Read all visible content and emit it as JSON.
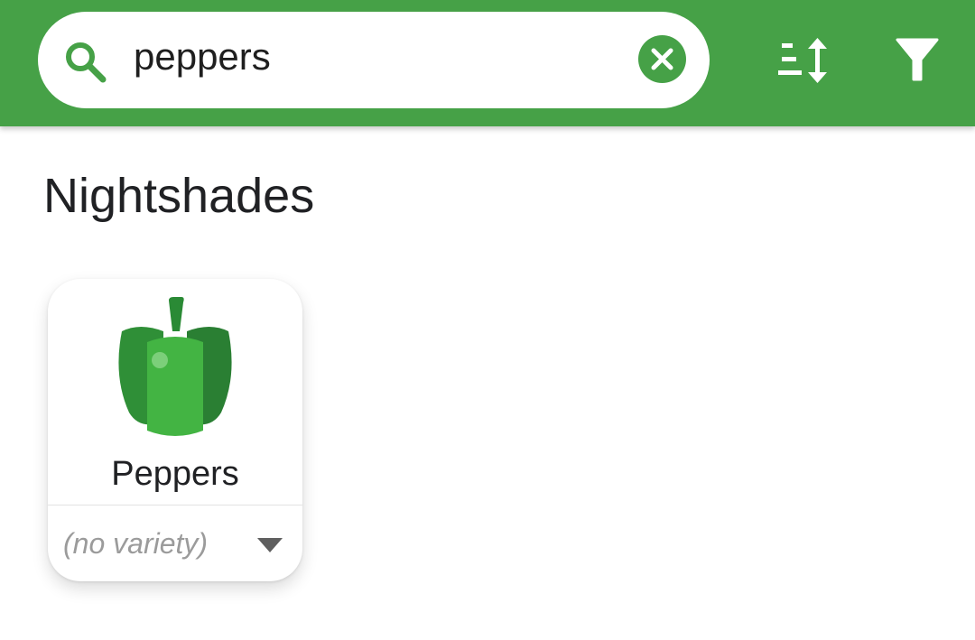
{
  "search": {
    "value": "peppers",
    "icon": "search-icon",
    "clear_icon": "close-circle-icon"
  },
  "toolbar": {
    "sort_icon": "sort-icon",
    "filter_icon": "filter-icon"
  },
  "section": {
    "title": "Nightshades"
  },
  "cards": [
    {
      "name": "Peppers",
      "icon": "bell-pepper-icon",
      "variety_placeholder": "(no variety)"
    }
  ],
  "colors": {
    "toolbar_green": "#46a147",
    "pepper_dark": "#2a8a35",
    "pepper_light": "#43b443"
  }
}
